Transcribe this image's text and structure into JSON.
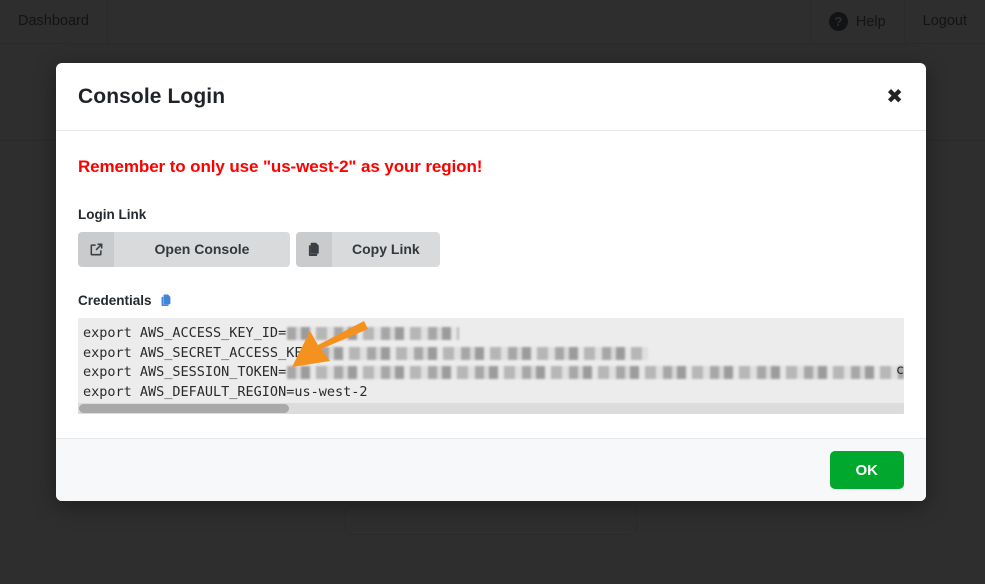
{
  "navbar": {
    "brand": "Dashboard",
    "help_label": "Help",
    "help_icon": "question-circle-icon",
    "logout_label": "Logout"
  },
  "page": {
    "title": ""
  },
  "modal": {
    "title": "Console Login",
    "close_icon": "✖",
    "warning": "Remember to only use \"us-west-2\" as your region!",
    "login_link": {
      "label": "Login Link",
      "open_console": {
        "icon": "external-link-icon",
        "label": "Open Console"
      },
      "copy_link": {
        "icon": "copy-icon",
        "label": "Copy Link"
      }
    },
    "credentials": {
      "label": "Credentials",
      "copy_icon": "copy-icon",
      "lines": [
        {
          "key": "export AWS_ACCESS_KEY_ID=",
          "value": "",
          "redacted": true,
          "redacted_width": 172
        },
        {
          "key": "export AWS_SECRET_ACCESS_KEY=",
          "value": "",
          "redacted": true,
          "redacted_width": 328
        },
        {
          "key": "export AWS_SESSION_TOKEN=",
          "value": "",
          "redacted": true,
          "redacted_width": 700
        },
        {
          "key": "export AWS_DEFAULT_REGION=",
          "value": "us-west-2",
          "redacted": false,
          "redacted_width": 0
        }
      ],
      "overflow_char": "c",
      "scroll_thumb_width": 210
    },
    "footer": {
      "ok_label": "OK"
    }
  },
  "annotation": {
    "arrow_color": "#f5911e",
    "points_at": "open-console-button"
  },
  "colors": {
    "warning_red": "#ff0000",
    "ok_green": "#00a82d",
    "copy_icon_blue": "#3f86d9",
    "overlay": "rgba(12,12,12,0.86)"
  }
}
